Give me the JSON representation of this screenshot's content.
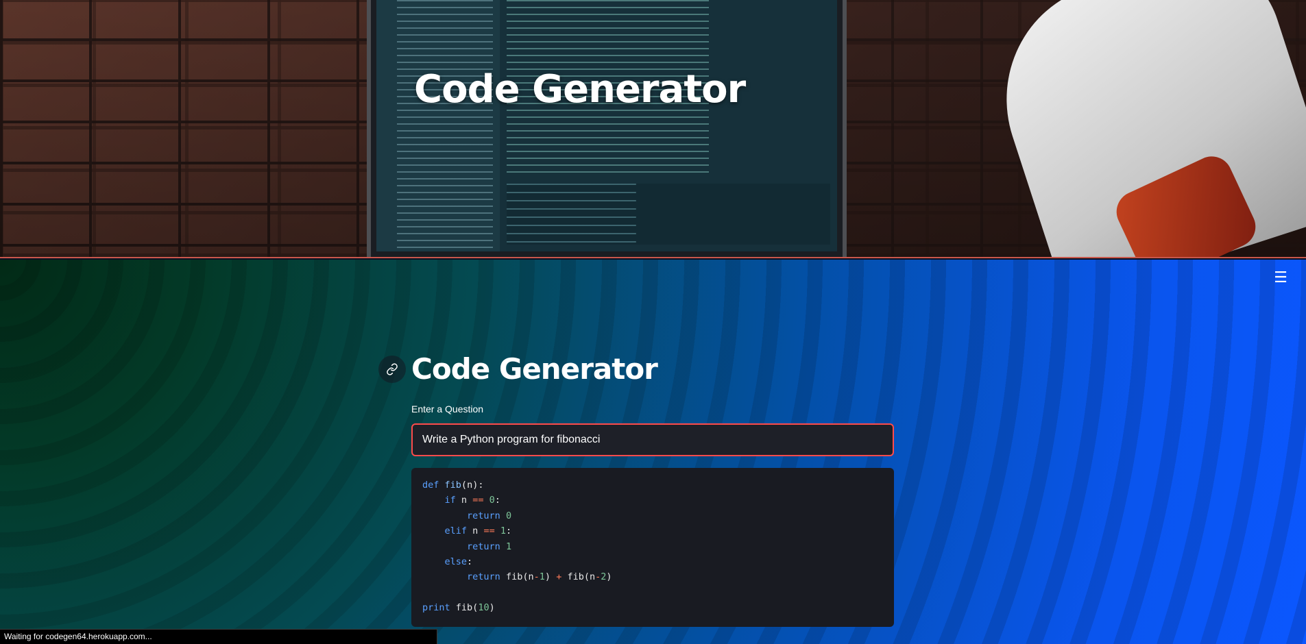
{
  "hero": {
    "title": "Code Generator",
    "image_subject": "laptop-code-editor-and-sneaker"
  },
  "header": {
    "menu_icon": "hamburger-menu-icon",
    "menu_glyph": "☰"
  },
  "main": {
    "anchor_icon": "link-icon",
    "title": "Code Generator",
    "input": {
      "label": "Enter a Question",
      "value": "Write a Python program for fibonacci"
    },
    "code": {
      "language": "python",
      "lines": [
        "def fib(n):",
        "    if n == 0:",
        "        return 0",
        "    elif n == 1:",
        "        return 1",
        "    else:",
        "        return fib(n-1) + fib(n-2)",
        "",
        "print fib(10)"
      ]
    }
  },
  "status_bar": {
    "text": "Waiting for codegen64.herokuapp.com..."
  },
  "colors": {
    "accent": "#ff4b4b",
    "input_bg": "#1e2028",
    "code_bg": "#191b22",
    "keyword": "#5aa0ff",
    "number": "#7ec699",
    "operator": "#ff7b5a"
  }
}
